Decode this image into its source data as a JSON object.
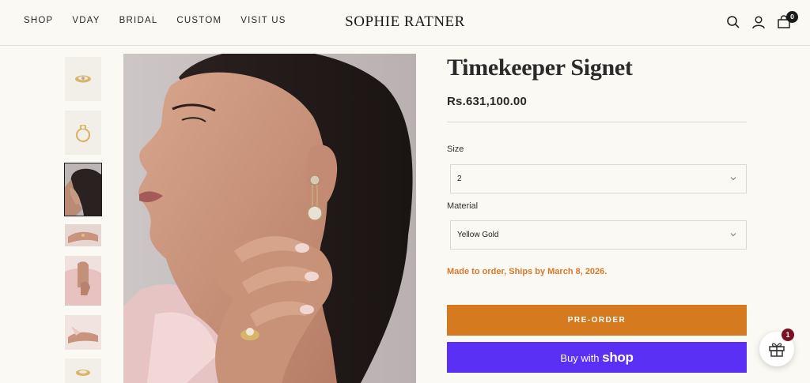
{
  "header": {
    "nav": [
      "SHOP",
      "VDAY",
      "BRIDAL",
      "CUSTOM",
      "VISIT US"
    ],
    "logo": "SOPHIE RATNER",
    "icons": [
      "search-icon",
      "account-icon",
      "cart-icon"
    ],
    "cart_count": "0"
  },
  "product": {
    "title": "Timekeeper Signet",
    "price": "Rs.631,100.00",
    "size_label": "Size",
    "size_value": "2",
    "material_label": "Material",
    "material_value": "Yellow Gold",
    "ship_notice": "Made to order, Ships by March 8, 2026.",
    "preorder_label": "PRE-ORDER",
    "buy_with": "Buy with",
    "shop_word": "shop"
  },
  "gift": {
    "badge": "1",
    "icon": "gift-icon"
  },
  "colors": {
    "accent": "#d57a1f",
    "shop_pay": "#5a31f4",
    "notice": "#d9782a",
    "gift_badge": "#7a1224",
    "background": "#fbf9f4"
  }
}
